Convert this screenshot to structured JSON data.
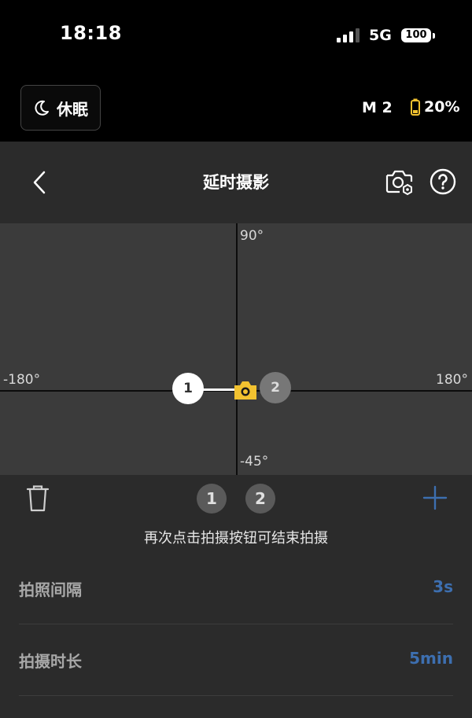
{
  "status_bar": {
    "time": "18:18",
    "network": "5G",
    "battery": "100"
  },
  "device": {
    "sleep_label": "休眠",
    "name": "M 2",
    "battery": "20%"
  },
  "header": {
    "title": "延时摄影"
  },
  "map": {
    "axis_top": "90°",
    "axis_bottom": "-45°",
    "axis_left": "-180°",
    "axis_right": "180°",
    "points": [
      "1",
      "2"
    ]
  },
  "keyframes": [
    "1",
    "2"
  ],
  "hint": "再次点击拍摄按钮可结束拍摄",
  "settings": [
    {
      "label": "拍照间隔",
      "value": "3s"
    },
    {
      "label": "拍摄时长",
      "value": "5min"
    }
  ],
  "colors": {
    "accent": "#3d6fb0",
    "camera_marker": "#f2c230",
    "battery_low": "#f2c230"
  },
  "icons": [
    "moon-icon",
    "battery-icon",
    "back-icon",
    "camera-settings-icon",
    "help-icon",
    "camera-icon",
    "trash-icon",
    "plus-icon"
  ]
}
